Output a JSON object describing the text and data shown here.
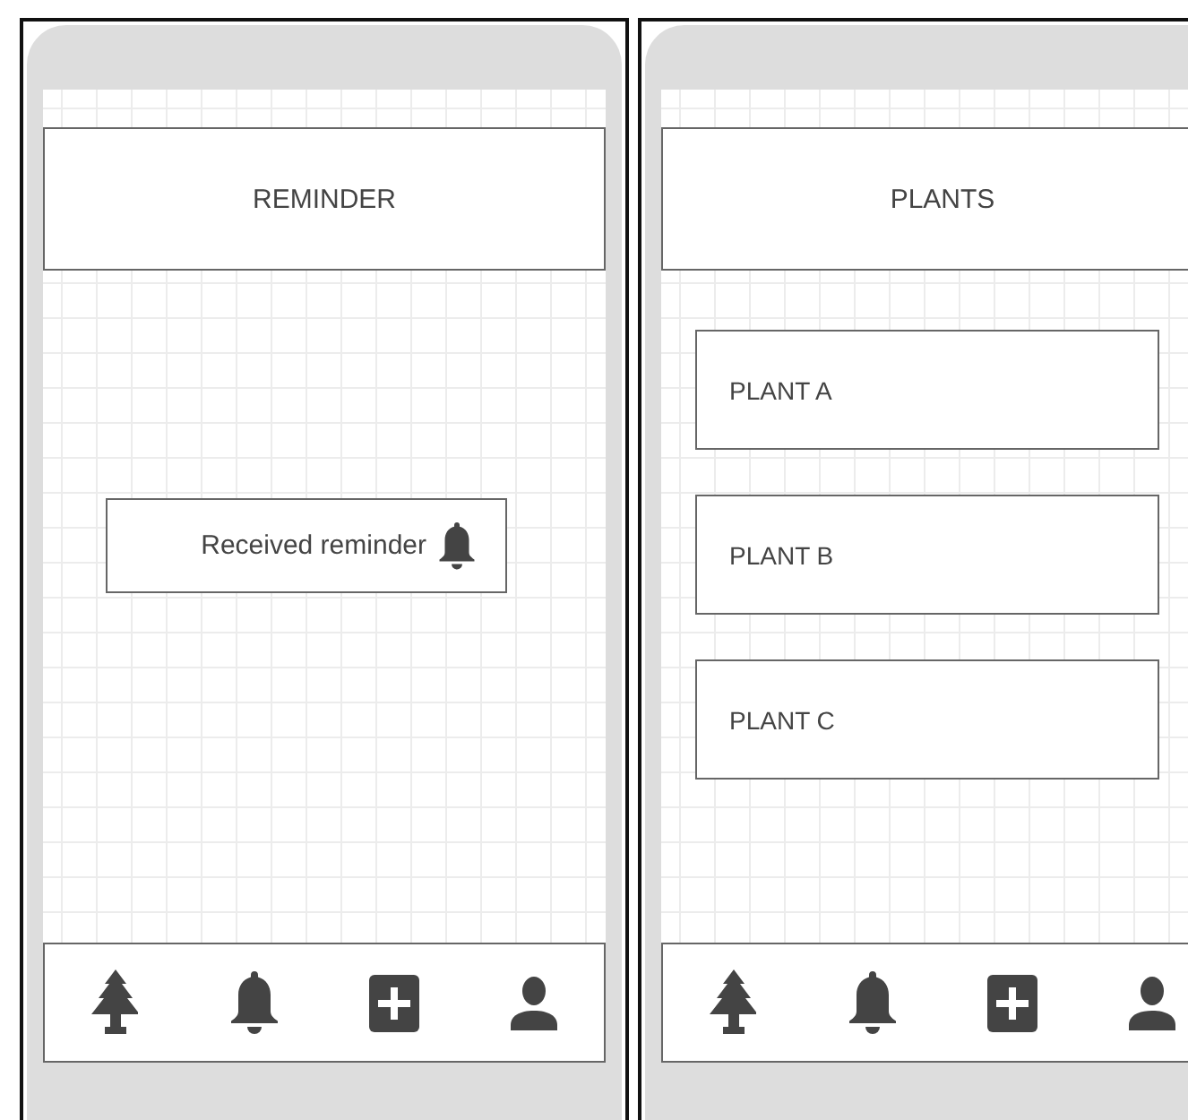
{
  "screens": [
    {
      "title": "REMINDER",
      "notification": {
        "text": "Received reminder"
      }
    },
    {
      "title": "PLANTS",
      "items": [
        "PLANT A",
        "PLANT B",
        "PLANT C"
      ]
    }
  ]
}
